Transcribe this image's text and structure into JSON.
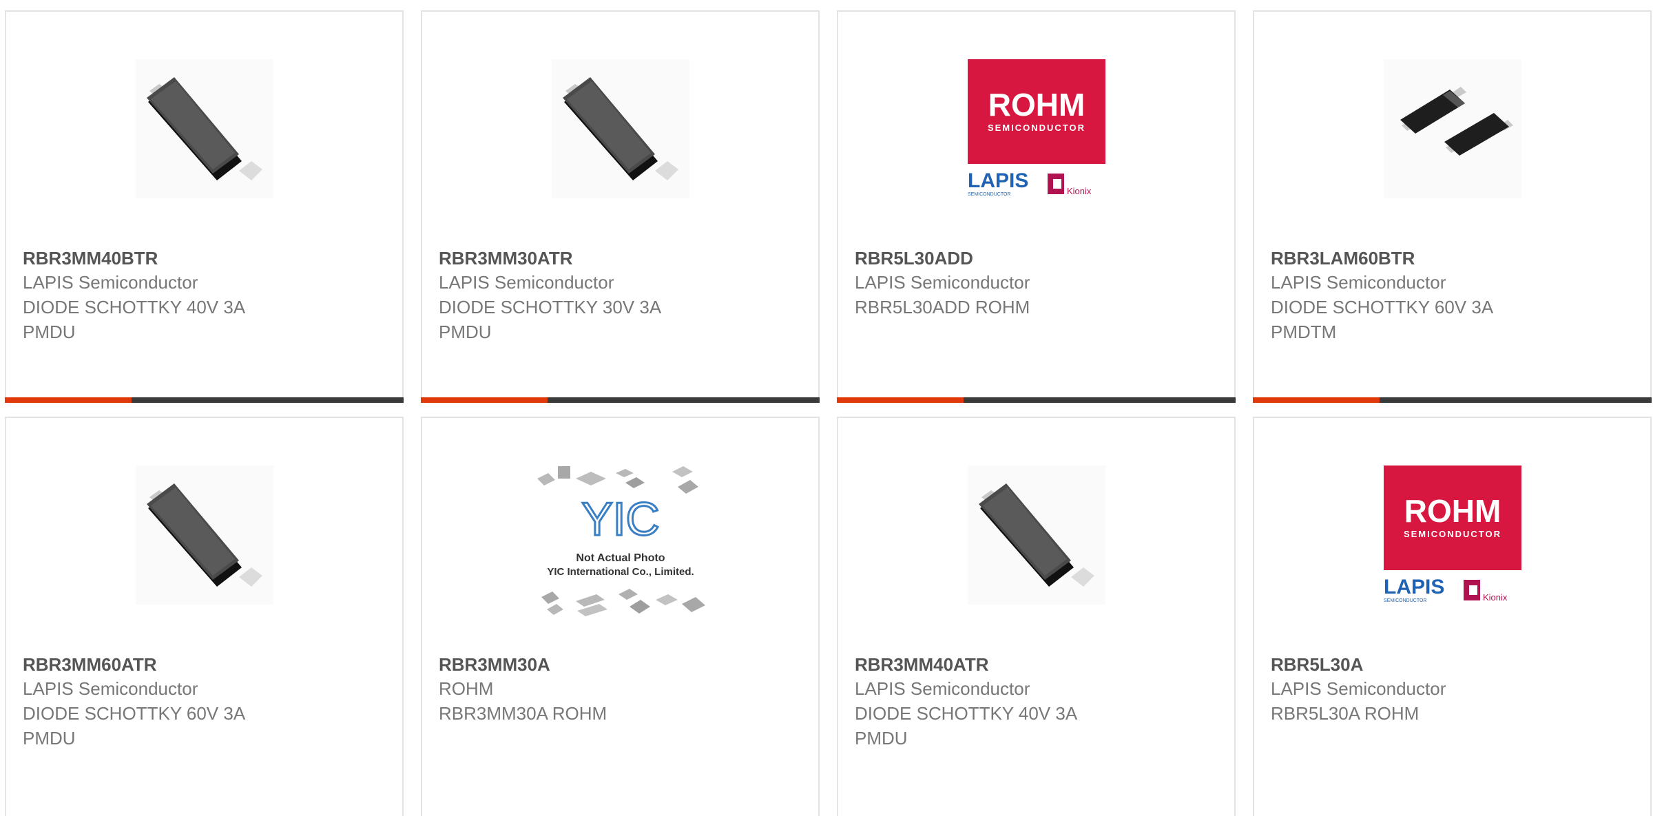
{
  "colors": {
    "accent": "#e03a0b",
    "bar_dark": "#3a3a3a",
    "rohm_red": "#d7173f",
    "lapis_blue": "#1f63b5"
  },
  "products": [
    {
      "part_number": "RBR3MM40BTR",
      "manufacturer": "LAPIS Semiconductor",
      "description_line1": "DIODE SCHOTTKY 40V 3A",
      "description_line2": "PMDU",
      "image": "pmdu-diode-package"
    },
    {
      "part_number": "RBR3MM30ATR",
      "manufacturer": "LAPIS Semiconductor",
      "description_line1": "DIODE SCHOTTKY 30V 3A",
      "description_line2": "PMDU",
      "image": "pmdu-diode-package"
    },
    {
      "part_number": "RBR5L30ADD",
      "manufacturer": "LAPIS Semiconductor",
      "description_line1": "RBR5L30ADD ROHM",
      "description_line2": "",
      "image": "rohm-lapis-kionix-logo",
      "logo_text": {
        "rohm": "ROHM",
        "semiconductor": "SEMICONDUCTOR",
        "lapis": "LAPIS",
        "lapis_sub": "SEMICONDUCTOR",
        "kionix": "Kionix"
      }
    },
    {
      "part_number": "RBR3LAM60BTR",
      "manufacturer": "LAPIS Semiconductor",
      "description_line1": "DIODE SCHOTTKY 60V 3A",
      "description_line2": "PMDTM",
      "image": "pmdtm-diode-package"
    },
    {
      "part_number": "RBR3MM60ATR",
      "manufacturer": "LAPIS Semiconductor",
      "description_line1": "DIODE SCHOTTKY 60V 3A",
      "description_line2": "PMDU",
      "image": "pmdu-diode-package"
    },
    {
      "part_number": "RBR3MM30A",
      "manufacturer": "ROHM",
      "description_line1": "RBR3MM30A ROHM",
      "description_line2": "",
      "image": "not-actual-photo-placeholder",
      "placeholder_text": {
        "logo": "YIC",
        "line1": "Not Actual Photo",
        "line2": "YIC International Co., Limited."
      }
    },
    {
      "part_number": "RBR3MM40ATR",
      "manufacturer": "LAPIS Semiconductor",
      "description_line1": "DIODE SCHOTTKY 40V 3A",
      "description_line2": "PMDU",
      "image": "pmdu-diode-package"
    },
    {
      "part_number": "RBR5L30A",
      "manufacturer": "LAPIS Semiconductor",
      "description_line1": "RBR5L30A ROHM",
      "description_line2": "",
      "image": "rohm-lapis-kionix-logo",
      "logo_text": {
        "rohm": "ROHM",
        "semiconductor": "SEMICONDUCTOR",
        "lapis": "LAPIS",
        "lapis_sub": "SEMICONDUCTOR",
        "kionix": "Kionix"
      }
    }
  ]
}
